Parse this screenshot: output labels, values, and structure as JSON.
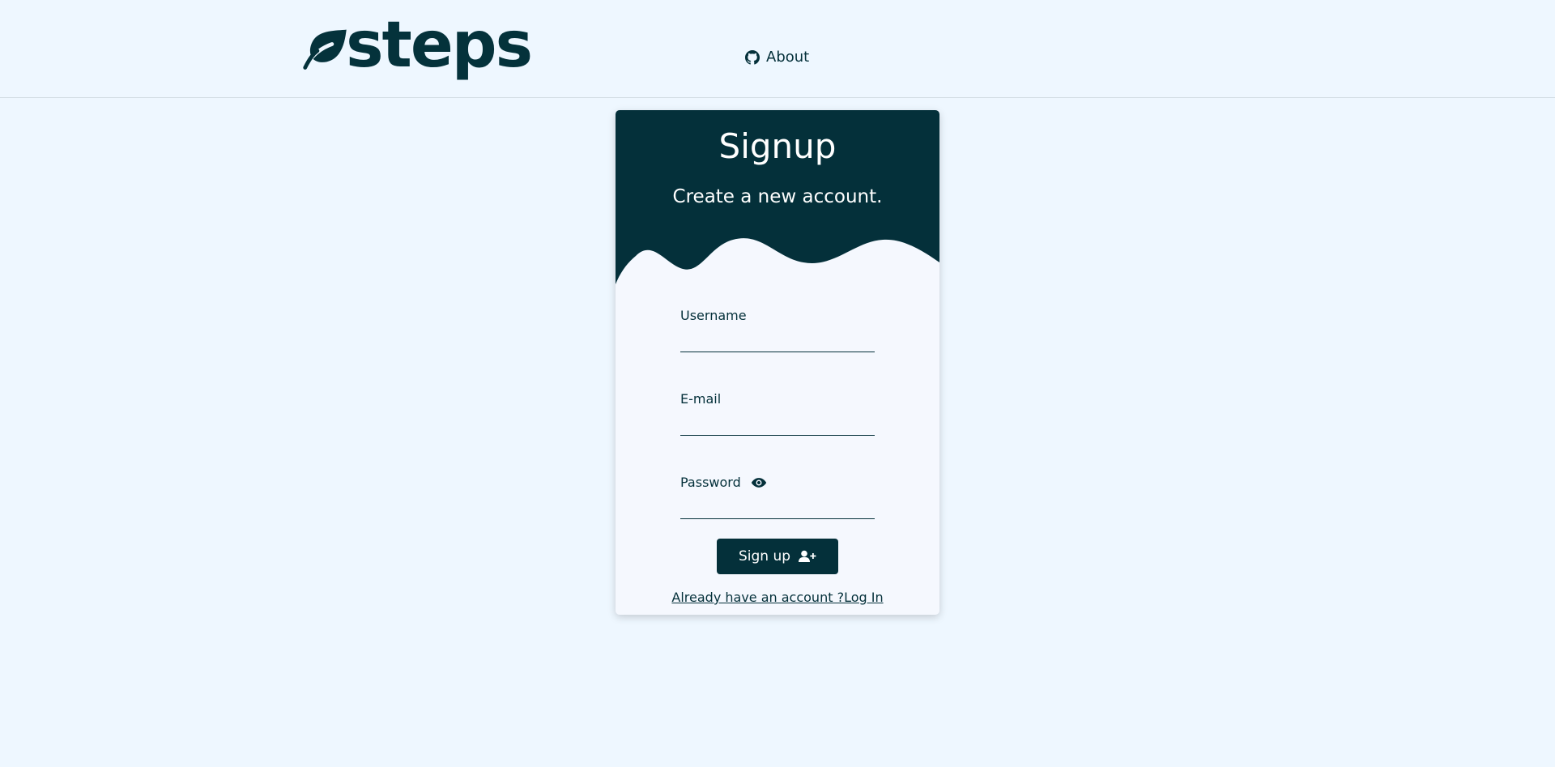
{
  "navbar": {
    "logo_text": "steps",
    "about_label": "About"
  },
  "card": {
    "title": "Signup",
    "subtitle": "Create a new account.",
    "username_label": "Username",
    "email_label": "E-mail",
    "password_label": "Password",
    "signup_label": "Sign up",
    "login_link": "Already have an account ?Log In"
  },
  "colors": {
    "background": "#eef7ff",
    "brand": "#04303a",
    "card": "#f5f8fe"
  },
  "icons": {
    "logo": "leaf-icon",
    "about": "github-icon",
    "password_toggle": "eye-icon",
    "signup": "user-plus-icon"
  }
}
